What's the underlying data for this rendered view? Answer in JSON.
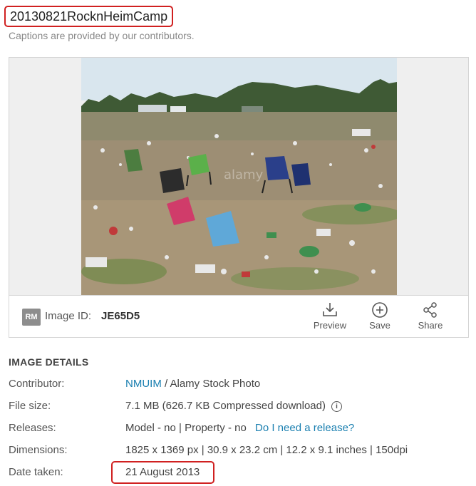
{
  "title": "20130821RocknHeimCamp",
  "caption_note": "Captions are provided by our contributors.",
  "image_meta": {
    "license_badge": "RM",
    "id_label": "Image ID:",
    "id_value": "JE65D5",
    "watermark": "alamy"
  },
  "actions": [
    {
      "label": "Preview",
      "icon": "download-icon"
    },
    {
      "label": "Save",
      "icon": "plus-circle-icon"
    },
    {
      "label": "Share",
      "icon": "share-icon"
    }
  ],
  "details": {
    "heading": "IMAGE DETAILS",
    "contributor_label": "Contributor:",
    "contributor_name": "NMUIM",
    "contributor_suffix": "/ Alamy Stock Photo",
    "file_size_label": "File size:",
    "file_size_value": "7.1 MB (626.7 KB Compressed download)",
    "releases_label": "Releases:",
    "releases_value": "Model - no | Property - no",
    "releases_link": "Do I need a release?",
    "dimensions_label": "Dimensions:",
    "dimensions_value": "1825 x 1369 px | 30.9 x 23.2 cm | 12.2 x 9.1 inches | 150dpi",
    "date_label": "Date taken:",
    "date_value": "21 August 2013"
  },
  "colors": {
    "highlight_border": "#d02020",
    "link": "#1a7fb0"
  }
}
